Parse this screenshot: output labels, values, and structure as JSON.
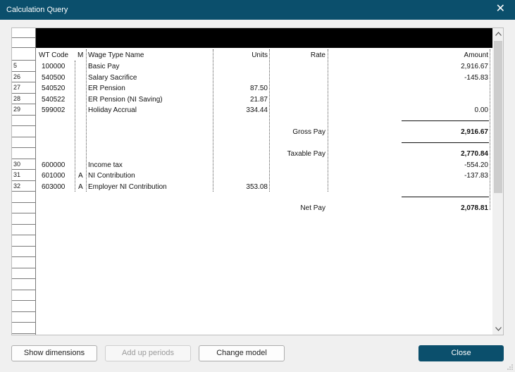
{
  "window": {
    "title": "Calculation Query",
    "close_glyph": "✕"
  },
  "columns": {
    "wt_code": "WT Code",
    "m": "M",
    "wage_type_name": "Wage Type Name",
    "units": "Units",
    "rate": "Rate",
    "amount": "Amount"
  },
  "rows": [
    {
      "n": "5",
      "code": "100000",
      "m": "",
      "name": "Basic Pay",
      "units": "",
      "rate": "",
      "amount": "2,916.67"
    },
    {
      "n": "26",
      "code": "540500",
      "m": "",
      "name": "Salary Sacrifice",
      "units": "",
      "rate": "",
      "amount": "-145.83"
    },
    {
      "n": "27",
      "code": "540520",
      "m": "",
      "name": "ER Pension",
      "units": "87.50",
      "rate": "",
      "amount": ""
    },
    {
      "n": "28",
      "code": "540522",
      "m": "",
      "name": "ER Pension (NI Saving)",
      "units": "21.87",
      "rate": "",
      "amount": ""
    },
    {
      "n": "29",
      "code": "599002",
      "m": "",
      "name": "Holiday Accrual",
      "units": "334.44",
      "rate": "",
      "amount": "0.00"
    },
    {
      "n": "30",
      "code": "600000",
      "m": "",
      "name": "Income tax",
      "units": "",
      "rate": "",
      "amount": "-554.20"
    },
    {
      "n": "31",
      "code": "601000",
      "m": "A",
      "name": "NI Contribution",
      "units": "",
      "rate": "",
      "amount": "-137.83"
    },
    {
      "n": "32",
      "code": "603000",
      "m": "A",
      "name": "Employer NI Contribution",
      "units": "353.08",
      "rate": "",
      "amount": ""
    }
  ],
  "totals": {
    "gross_label": "Gross Pay",
    "gross_value": "2,916.67",
    "taxable_label": "Taxable Pay",
    "taxable_value": "2,770.84",
    "net_label": "Net Pay",
    "net_value": "2,078.81"
  },
  "buttons": {
    "show_dimensions": "Show dimensions",
    "add_up_periods": "Add up periods",
    "change_model": "Change model",
    "close": "Close"
  },
  "icons": {
    "scroll_up": "chevron-up-icon",
    "scroll_down": "chevron-down-icon",
    "close": "close-icon",
    "resize": "resize-grip-icon"
  },
  "colors": {
    "titlebar": "#0b4f6c",
    "primary_button": "#0b4f6c"
  }
}
